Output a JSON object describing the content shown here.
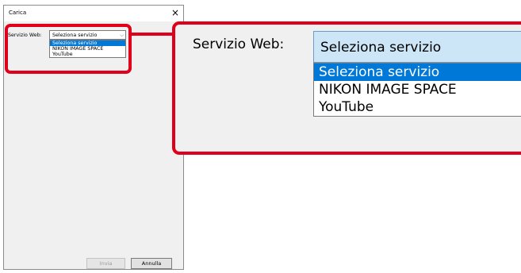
{
  "dialog": {
    "title": "Carica",
    "close_glyph": "×",
    "service_label": "Servizio Web:",
    "select": {
      "value": "Seleziona servizio",
      "chevron": "⌵",
      "options": [
        "Seleziona servizio",
        "NIKON IMAGE SPACE",
        "YouTube"
      ],
      "selected_index": 0
    },
    "buttons": {
      "send": "Invia",
      "cancel": "Annulla"
    }
  },
  "zoom": {
    "service_label": "Servizio Web:",
    "select_value": "Seleziona servizio",
    "options": [
      "Seleziona servizio",
      "NIKON IMAGE SPACE",
      "YouTube"
    ]
  },
  "colors": {
    "highlight": "#e0001b",
    "selection": "#0078d7"
  }
}
